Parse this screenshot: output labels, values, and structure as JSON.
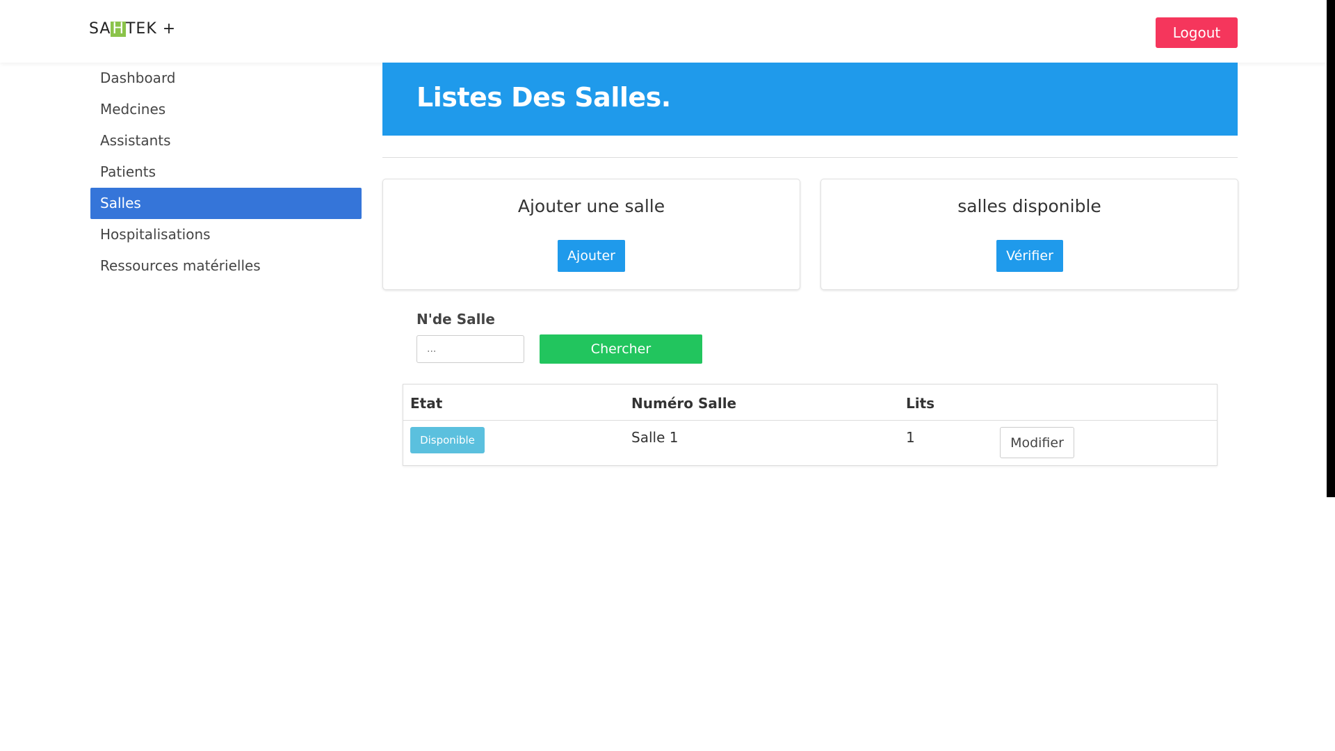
{
  "header": {
    "brand_prefix": "SA",
    "brand_highlight": "H",
    "brand_suffix": "TEK +",
    "logout_label": "Logout"
  },
  "sidebar": {
    "items": [
      {
        "label": "Dashboard",
        "active": false
      },
      {
        "label": "Medcines",
        "active": false
      },
      {
        "label": "Assistants",
        "active": false
      },
      {
        "label": "Patients",
        "active": false
      },
      {
        "label": "Salles",
        "active": true
      },
      {
        "label": "Hospitalisations",
        "active": false
      },
      {
        "label": "Ressources matérielles",
        "active": false
      }
    ]
  },
  "banner": {
    "title": "Listes Des Salles."
  },
  "cards": {
    "add": {
      "title": "Ajouter une salle",
      "button": "Ajouter"
    },
    "available": {
      "title": "salles disponible",
      "button": "Vérifier"
    }
  },
  "search": {
    "label": "N'de Salle",
    "placeholder": "...",
    "button": "Chercher"
  },
  "table": {
    "headers": [
      "Etat",
      "Numéro Salle",
      "Lits"
    ],
    "rows": [
      {
        "etat": "Disponible",
        "numero": "Salle 1",
        "lits": "1",
        "action": "Modifier"
      }
    ]
  },
  "colors": {
    "primary": "#1f9aeb",
    "sidebar_active": "#3575d9",
    "logout": "#f5365c",
    "search_button": "#22c55e",
    "badge": "#5bc0de",
    "brand_highlight": "#8bc34a"
  }
}
